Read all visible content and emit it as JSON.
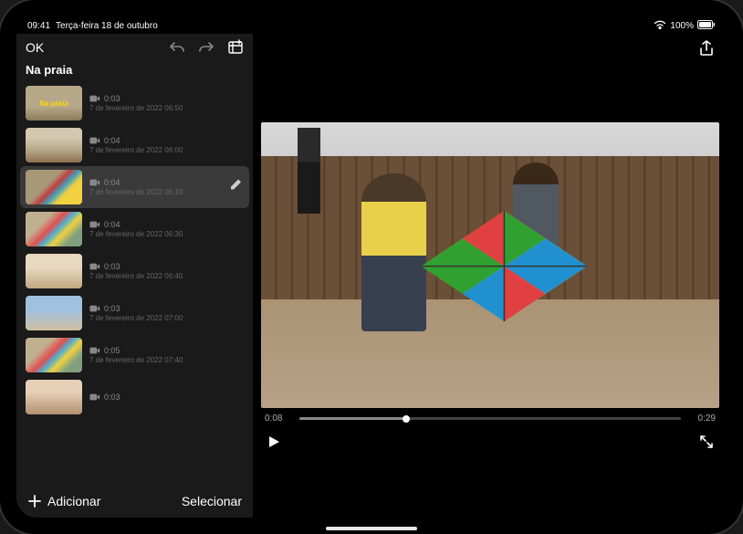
{
  "status": {
    "time": "09:41",
    "date": "Terça-feira 18 de outubro",
    "battery_pct": "100%"
  },
  "sidebar": {
    "ok_label": "OK",
    "project_title": "Na praia",
    "add_label": "Adicionar",
    "select_label": "Selecionar"
  },
  "clips": [
    {
      "duration": "0:03",
      "date": "7 de fevereiro de 2022 06:50",
      "title_overlay": "Na praia",
      "selected": false,
      "thumb_class": "title-clip",
      "has_title": true
    },
    {
      "duration": "0:04",
      "date": "7 de fevereiro de 2022 06:00",
      "selected": false,
      "thumb_class": "thumb-beach"
    },
    {
      "duration": "0:04",
      "date": "7 de fevereiro de 2022 06:10",
      "selected": true,
      "thumb_class": "thumb-kite",
      "editing": true
    },
    {
      "duration": "0:04",
      "date": "7 de fevereiro de 2022 06:30",
      "selected": false,
      "thumb_class": "thumb-kite2"
    },
    {
      "duration": "0:03",
      "date": "7 de fevereiro de 2022 06:40",
      "selected": false,
      "thumb_class": "thumb-people"
    },
    {
      "duration": "0:03",
      "date": "7 de fevereiro de 2022 07:00",
      "selected": false,
      "thumb_class": "thumb-sky"
    },
    {
      "duration": "0:05",
      "date": "7 de fevereiro de 2022 07:40",
      "selected": false,
      "thumb_class": "thumb-kite2"
    },
    {
      "duration": "0:03",
      "date": "",
      "selected": false,
      "thumb_class": "thumb-family"
    }
  ],
  "player": {
    "current_time": "0:08",
    "total_time": "0:29",
    "progress_pct": 28
  }
}
